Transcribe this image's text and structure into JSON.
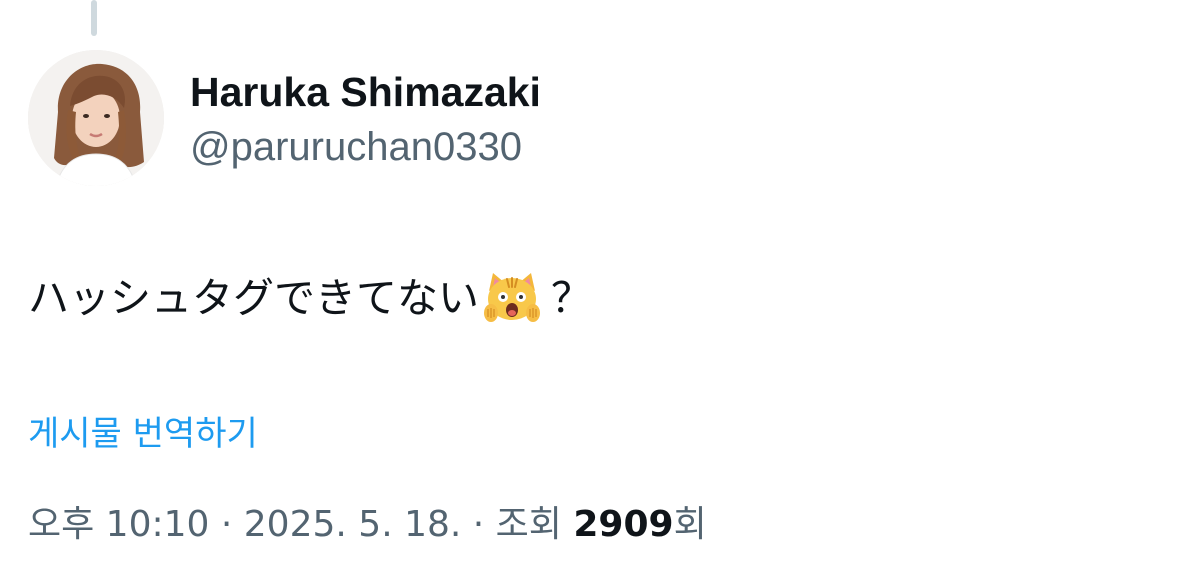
{
  "author": {
    "name": "Haruka Shimazaki",
    "handle": "@paruruchan0330",
    "avatar_icon": "user-photo-avatar"
  },
  "tweet": {
    "text": "ハッシュタグできてない",
    "emoji": "weary-cat-emoji",
    "text_suffix": "？"
  },
  "translate_label": "게시물 번역하기",
  "meta": {
    "time": "오후 10:10",
    "separator": " · ",
    "date": "2025. 5. 18.",
    "views_label": "조회 ",
    "views_count": "2909",
    "views_suffix": "회"
  },
  "colors": {
    "text_primary": "#0f1419",
    "text_secondary": "#536471",
    "link": "#1d9bf0",
    "thread_line": "#cfd9de"
  }
}
